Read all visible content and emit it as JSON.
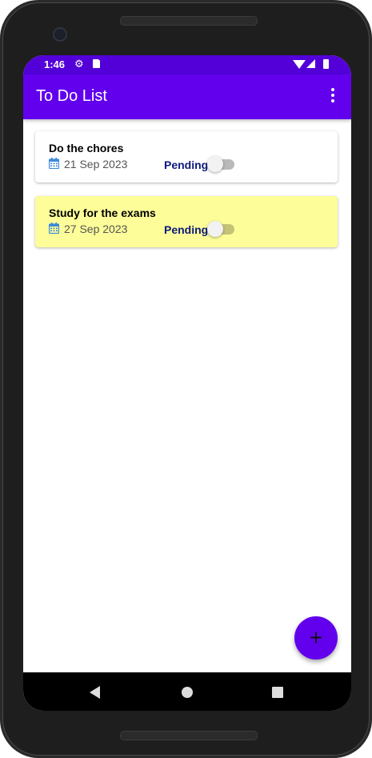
{
  "status_bar": {
    "time": "1:46",
    "icons": [
      "settings-icon",
      "sd-card-icon",
      "wifi-icon",
      "signal-icon",
      "battery-icon"
    ]
  },
  "app_bar": {
    "title": "To Do List",
    "overflow_icon": "more-vert-icon"
  },
  "tasks": [
    {
      "title": "Do the chores",
      "date": "21 Sep 2023",
      "status": "Pending",
      "completed": false,
      "background": "#ffffff"
    },
    {
      "title": "Study for the exams",
      "date": "27 Sep 2023",
      "status": "Pending",
      "completed": false,
      "background": "#fdfd99"
    }
  ],
  "fab": {
    "label": "+",
    "icon": "add-icon"
  },
  "nav_bar": {
    "icons": [
      "back-icon",
      "home-icon",
      "recents-icon"
    ]
  },
  "colors": {
    "primary": "#6200ee",
    "status_bar": "#5300d8",
    "status_text": "#0d1a7a",
    "calendar_icon": "#3b8ad9",
    "highlight_card": "#fdfd99"
  }
}
